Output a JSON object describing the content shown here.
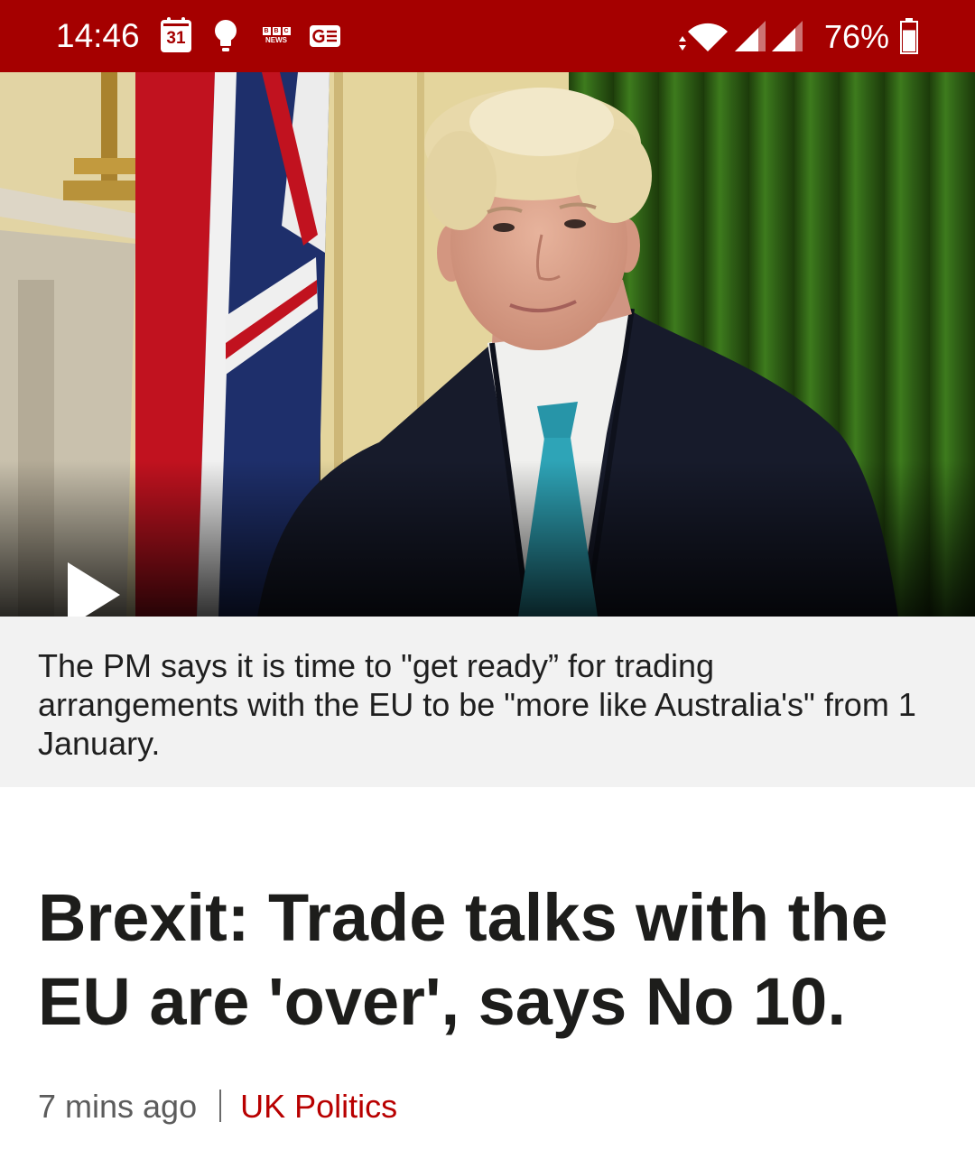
{
  "status_bar": {
    "time": "14:46",
    "calendar_day": "31",
    "bbc_logo_letters": [
      "B",
      "B",
      "C"
    ],
    "bbc_news_label": "NEWS",
    "battery_percent": "76%",
    "battery_level": 0.76,
    "background_color": "#a50000",
    "left_icons": [
      "calendar-icon",
      "lightbulb-icon",
      "bbc-news-icon",
      "google-news-icon"
    ],
    "right_icons": [
      "wifi-icon",
      "signal-icon",
      "signal-icon",
      "battery-icon"
    ]
  },
  "video": {
    "play_icon": "play-icon"
  },
  "caption": {
    "background_color": "#f2f2f2",
    "lines": [
      "The PM says it is time to \"get ready” for trading",
      "arrangements with the EU to be \"more like Australia's\" from 1",
      "January."
    ]
  },
  "article": {
    "headline": "Brexit: Trade talks with the EU are 'over', says No 10.",
    "timestamp": "7 mins ago",
    "category": "UK Politics",
    "category_color": "#b80000"
  }
}
